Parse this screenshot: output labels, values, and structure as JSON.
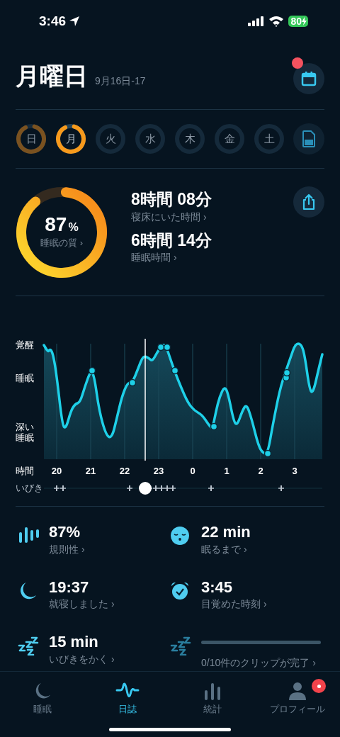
{
  "status_bar": {
    "time": "3:46",
    "battery": "80"
  },
  "header": {
    "title": "月曜日",
    "date": "9月16日-17",
    "calendar_badge": true
  },
  "days": [
    {
      "label": "日",
      "selected": false,
      "recorded": true
    },
    {
      "label": "月",
      "selected": true,
      "recorded": true
    },
    {
      "label": "火",
      "selected": false,
      "recorded": false
    },
    {
      "label": "水",
      "selected": false,
      "recorded": false
    },
    {
      "label": "木",
      "selected": false,
      "recorded": false
    },
    {
      "label": "金",
      "selected": false,
      "recorded": false
    },
    {
      "label": "土",
      "selected": false,
      "recorded": false
    }
  ],
  "summary": {
    "quality": {
      "value": "87",
      "unit": "%",
      "label": "睡眠の質 ›"
    },
    "metrics": [
      {
        "value": "8時間 08分",
        "label": "寝床にいた時間 ›"
      },
      {
        "value": "6時間 14分",
        "label": "睡眠時間 ›"
      }
    ]
  },
  "hypnogram": {
    "stages": [
      "覚醒",
      "睡眠",
      "深い睡眠"
    ],
    "axis_label": "時間",
    "hours": [
      "20",
      "21",
      "22",
      "23",
      "0",
      "1",
      "2",
      "3"
    ],
    "snore_label": "いびき"
  },
  "stats": [
    {
      "kind": "regularity",
      "value": "87%",
      "label": "規則性 ›"
    },
    {
      "kind": "latency",
      "value": "22 min",
      "label": "眠るまで ›"
    },
    {
      "kind": "bedtime",
      "value": "19:37",
      "label": "就寝しました ›"
    },
    {
      "kind": "wake",
      "value": "3:45",
      "label": "目覚めた時刻 ›"
    },
    {
      "kind": "snoring",
      "value": "15 min",
      "label": "いびきをかく ›"
    },
    {
      "kind": "clips",
      "label": "0/10件のクリップが完了 ›"
    }
  ],
  "tab_bar": [
    {
      "kind": "moon",
      "label": "睡眠",
      "selected": false,
      "badge": false
    },
    {
      "kind": "wave",
      "label": "日誌",
      "selected": true,
      "badge": false
    },
    {
      "kind": "bars",
      "label": "統計",
      "selected": false,
      "badge": false
    },
    {
      "kind": "person",
      "label": "プロフィール",
      "selected": false,
      "badge": true
    }
  ]
}
